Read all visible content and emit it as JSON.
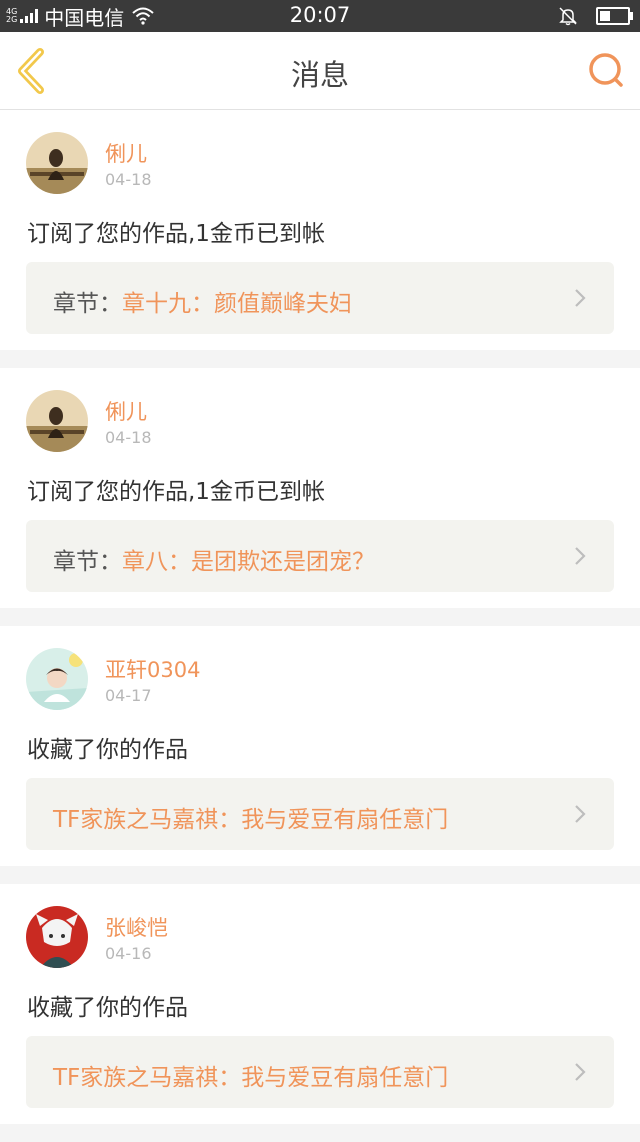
{
  "status_bar": {
    "network_top": "4G",
    "network_bottom": "2G",
    "carrier": "中国电信",
    "time": "20:07",
    "battery_level": 0.4
  },
  "header": {
    "title": "消息",
    "back_icon": "chevron-left-icon",
    "search_icon": "search-icon"
  },
  "colors": {
    "accent": "#f0945a",
    "back_icon": "#f2c84b",
    "card_inner_bg": "#f3f3ef"
  },
  "messages": [
    {
      "user": "俐儿",
      "date": "04-18",
      "text": "订阅了您的作品,1金币已到帐",
      "prefix": "章节：",
      "title": "章十九：颜值巅峰夫妇"
    },
    {
      "user": "俐儿",
      "date": "04-18",
      "text": "订阅了您的作品,1金币已到帐",
      "prefix": "章节：",
      "title": "章八：是团欺还是团宠？"
    },
    {
      "user": "亚轩0304",
      "date": "04-17",
      "text": "收藏了你的作品",
      "prefix": "",
      "title": "TF家族之马嘉祺：我与爱豆有扇任意门"
    },
    {
      "user": "张峻恺",
      "date": "04-16",
      "text": "收藏了你的作品",
      "prefix": "",
      "title": "TF家族之马嘉祺：我与爱豆有扇任意门"
    }
  ]
}
